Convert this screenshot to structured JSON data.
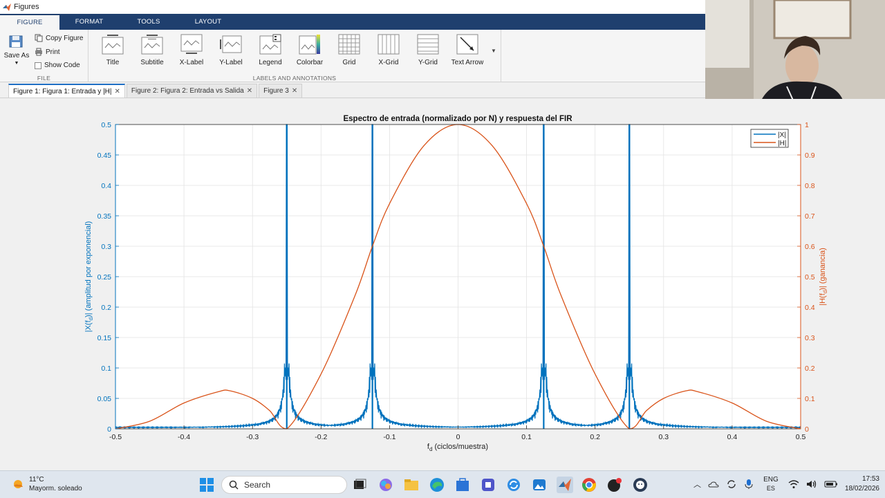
{
  "window": {
    "title": "Figures"
  },
  "ribbon_tabs": [
    "FIGURE",
    "FORMAT",
    "TOOLS",
    "LAYOUT"
  ],
  "file_group": {
    "save_as": "Save As",
    "copy_figure": "Copy Figure",
    "print": "Print",
    "show_code": "Show Code",
    "label": "FILE"
  },
  "labels_group": {
    "buttons": [
      "Title",
      "Subtitle",
      "X-Label",
      "Y-Label",
      "Legend",
      "Colorbar",
      "Grid",
      "X-Grid",
      "Y-Grid",
      "Text Arrow"
    ],
    "label": "LABELS AND ANNOTATIONS"
  },
  "doc_tabs": [
    "Figure 1: Figura 1: Entrada y |H|",
    "Figure 2: Figura 2: Entrada vs Salida",
    "Figure 3"
  ],
  "chart_data": {
    "type": "line",
    "title": "Espectro de entrada (normalizado por N) y respuesta del FIR",
    "xlabel": "f_d (ciclos/muestra)",
    "ylabel_left": "|X(f_d)| (amplitud por exponencial)",
    "ylabel_right": "|H(f_d)| (ganancia)",
    "xlim": [
      -0.5,
      0.5
    ],
    "ylim_left": [
      0,
      0.5
    ],
    "ylim_right": [
      0,
      1
    ],
    "xticks": [
      "-0.5",
      "-0.4",
      "-0.3",
      "-0.2",
      "-0.1",
      "0",
      "0.1",
      "0.2",
      "0.3",
      "0.4",
      "0.5"
    ],
    "yticks_left": [
      "0",
      "0.05",
      "0.1",
      "0.15",
      "0.2",
      "0.25",
      "0.3",
      "0.35",
      "0.4",
      "0.45",
      "0.5"
    ],
    "yticks_right": [
      "0",
      "0.1",
      "0.2",
      "0.3",
      "0.4",
      "0.5",
      "0.6",
      "0.7",
      "0.8",
      "0.9",
      "1"
    ],
    "grid": true,
    "legend_position": "top-right",
    "colors": {
      "X": "#0072bd",
      "H": "#d95319"
    },
    "series": [
      {
        "name": "|X|",
        "axis": "left",
        "peaks": [
          {
            "x": -0.25,
            "y": 0.5
          },
          {
            "x": -0.125,
            "y": 0.5
          },
          {
            "x": 0.125,
            "y": 0.5
          },
          {
            "x": 0.25,
            "y": 0.5
          }
        ],
        "sidelobe_peak": 0.11
      },
      {
        "name": "|H|",
        "axis": "right",
        "x": [
          -0.5,
          -0.45,
          -0.4,
          -0.35,
          -0.333,
          -0.3,
          -0.275,
          -0.25,
          -0.2,
          -0.15,
          -0.125,
          -0.1,
          -0.05,
          0,
          0.05,
          0.1,
          0.125,
          0.15,
          0.2,
          0.25,
          0.275,
          0.3,
          0.333,
          0.35,
          0.4,
          0.45,
          0.5
        ],
        "y": [
          0,
          0.025,
          0.085,
          0.122,
          0.125,
          0.1,
          0.06,
          0,
          0.18,
          0.44,
          0.6,
          0.74,
          0.93,
          1,
          0.93,
          0.74,
          0.6,
          0.44,
          0.18,
          0,
          0.06,
          0.1,
          0.125,
          0.122,
          0.085,
          0.025,
          0
        ]
      }
    ]
  },
  "taskbar": {
    "weather_temp": "11°C",
    "weather_desc": "Mayorm. soleado",
    "search_placeholder": "Search",
    "lang": "ENG",
    "lang_sub": "ES",
    "time": "17:53",
    "date": "18/02/2026"
  }
}
